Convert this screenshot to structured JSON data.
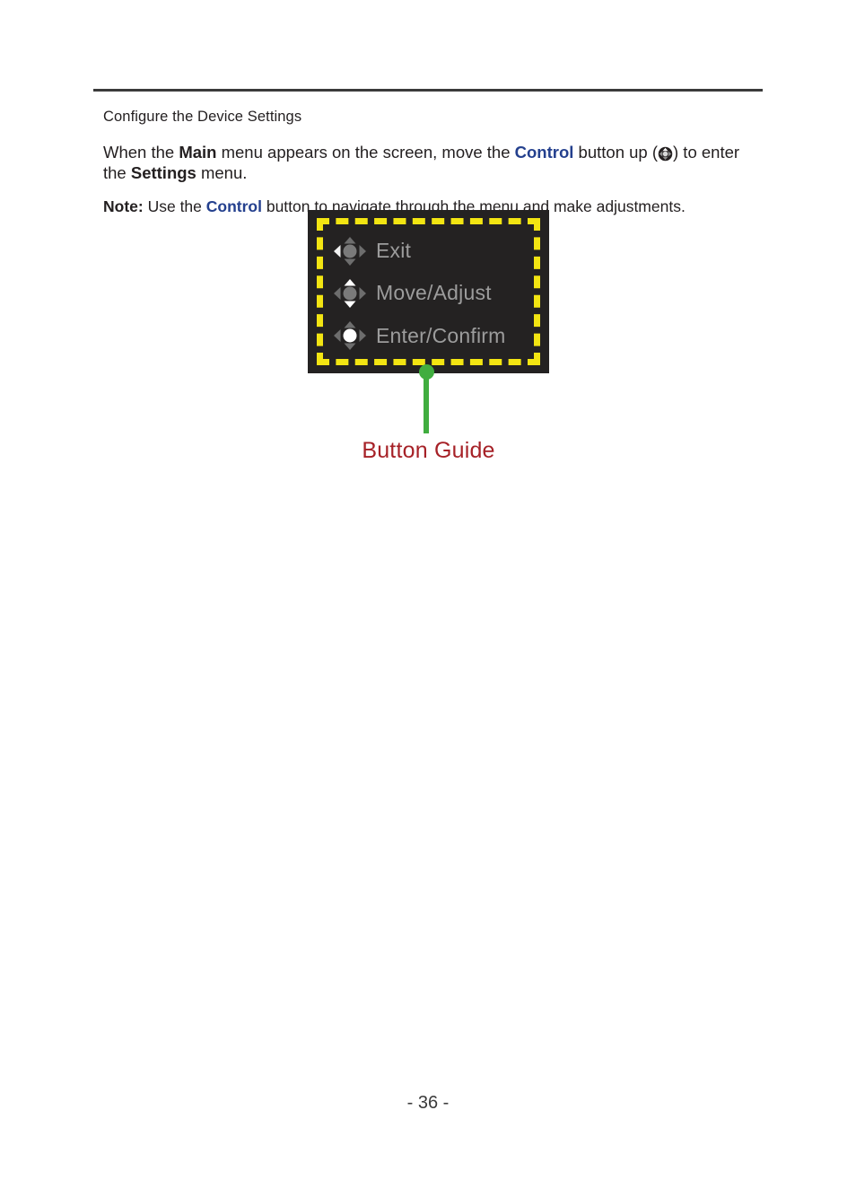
{
  "page": {
    "number_label": "- 36 -"
  },
  "content": {
    "subheading": "Configure the Device Settings",
    "paragraph": {
      "seg1": "When the ",
      "bold1": "Main",
      "seg2": " menu appears on the screen, move the ",
      "control1": "Control",
      "seg3": " button up (",
      "seg4": ") to enter the ",
      "bold2": "Settings",
      "seg5": " menu."
    },
    "note": {
      "label": "Note:",
      "seg1": " Use the ",
      "control1": "Control",
      "seg2": " button to navigate through the menu and make adjustments."
    }
  },
  "osd": {
    "rows": [
      {
        "icon": "dpad-left-icon",
        "label": "Exit"
      },
      {
        "icon": "dpad-up-down-icon",
        "label": "Move/Adjust"
      },
      {
        "icon": "dpad-center-icon",
        "label": "Enter/Confirm"
      }
    ]
  },
  "callout": {
    "label": "Button Guide"
  },
  "colors": {
    "control_blue": "#24408e",
    "callout_red": "#a62127",
    "callout_green": "#40ad3f",
    "highlight_yellow": "#f3e512",
    "osd_background": "#242222",
    "osd_text": "#9c9c9c",
    "rule_gray": "#3b3b3b"
  }
}
